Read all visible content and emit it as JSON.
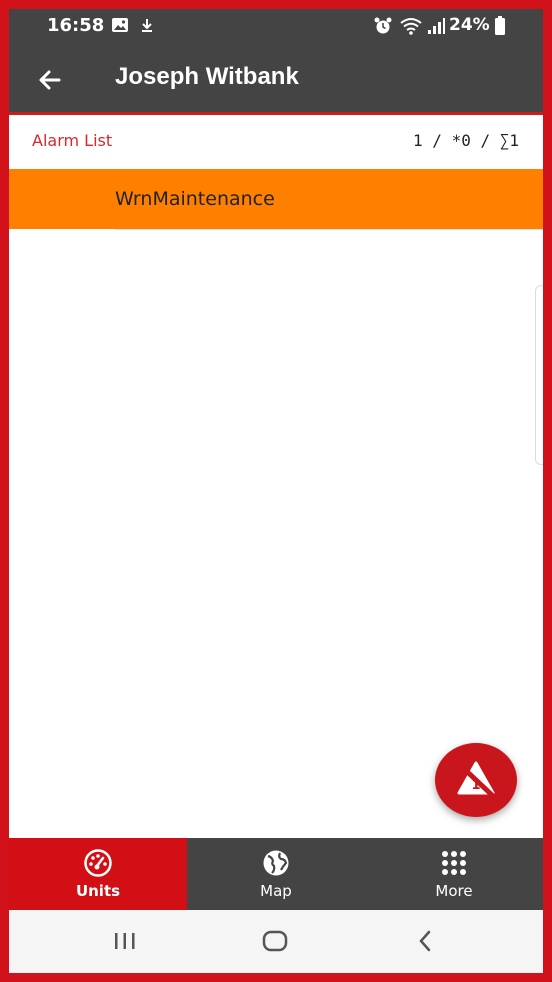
{
  "status_bar": {
    "time": "16:58",
    "battery": "24%",
    "icons": [
      "image-icon",
      "download-icon",
      "alarm-icon",
      "wifi-icon",
      "signal-icon",
      "battery-icon"
    ]
  },
  "app_bar": {
    "title": "Joseph Witbank",
    "back_icon": "arrow-left-icon"
  },
  "list_header": {
    "label": "Alarm List",
    "counts": "1 / *0 / ∑1"
  },
  "alarms": [
    {
      "text": "WrnMaintenance",
      "color": "#ff8000"
    }
  ],
  "fab": {
    "icon": "no-warning-icon",
    "badge": "1"
  },
  "bottom_nav": [
    {
      "label": "Units",
      "icon": "speedometer-icon",
      "active": true
    },
    {
      "label": "Map",
      "icon": "globe-icon",
      "active": false
    },
    {
      "label": "More",
      "icon": "grid-dots-icon",
      "active": false
    }
  ],
  "colors": {
    "accent_red": "#d10f14",
    "toolbar": "#444444",
    "alarm_orange": "#ff8000"
  },
  "system_nav": [
    "recents-icon",
    "home-icon",
    "back-icon"
  ]
}
